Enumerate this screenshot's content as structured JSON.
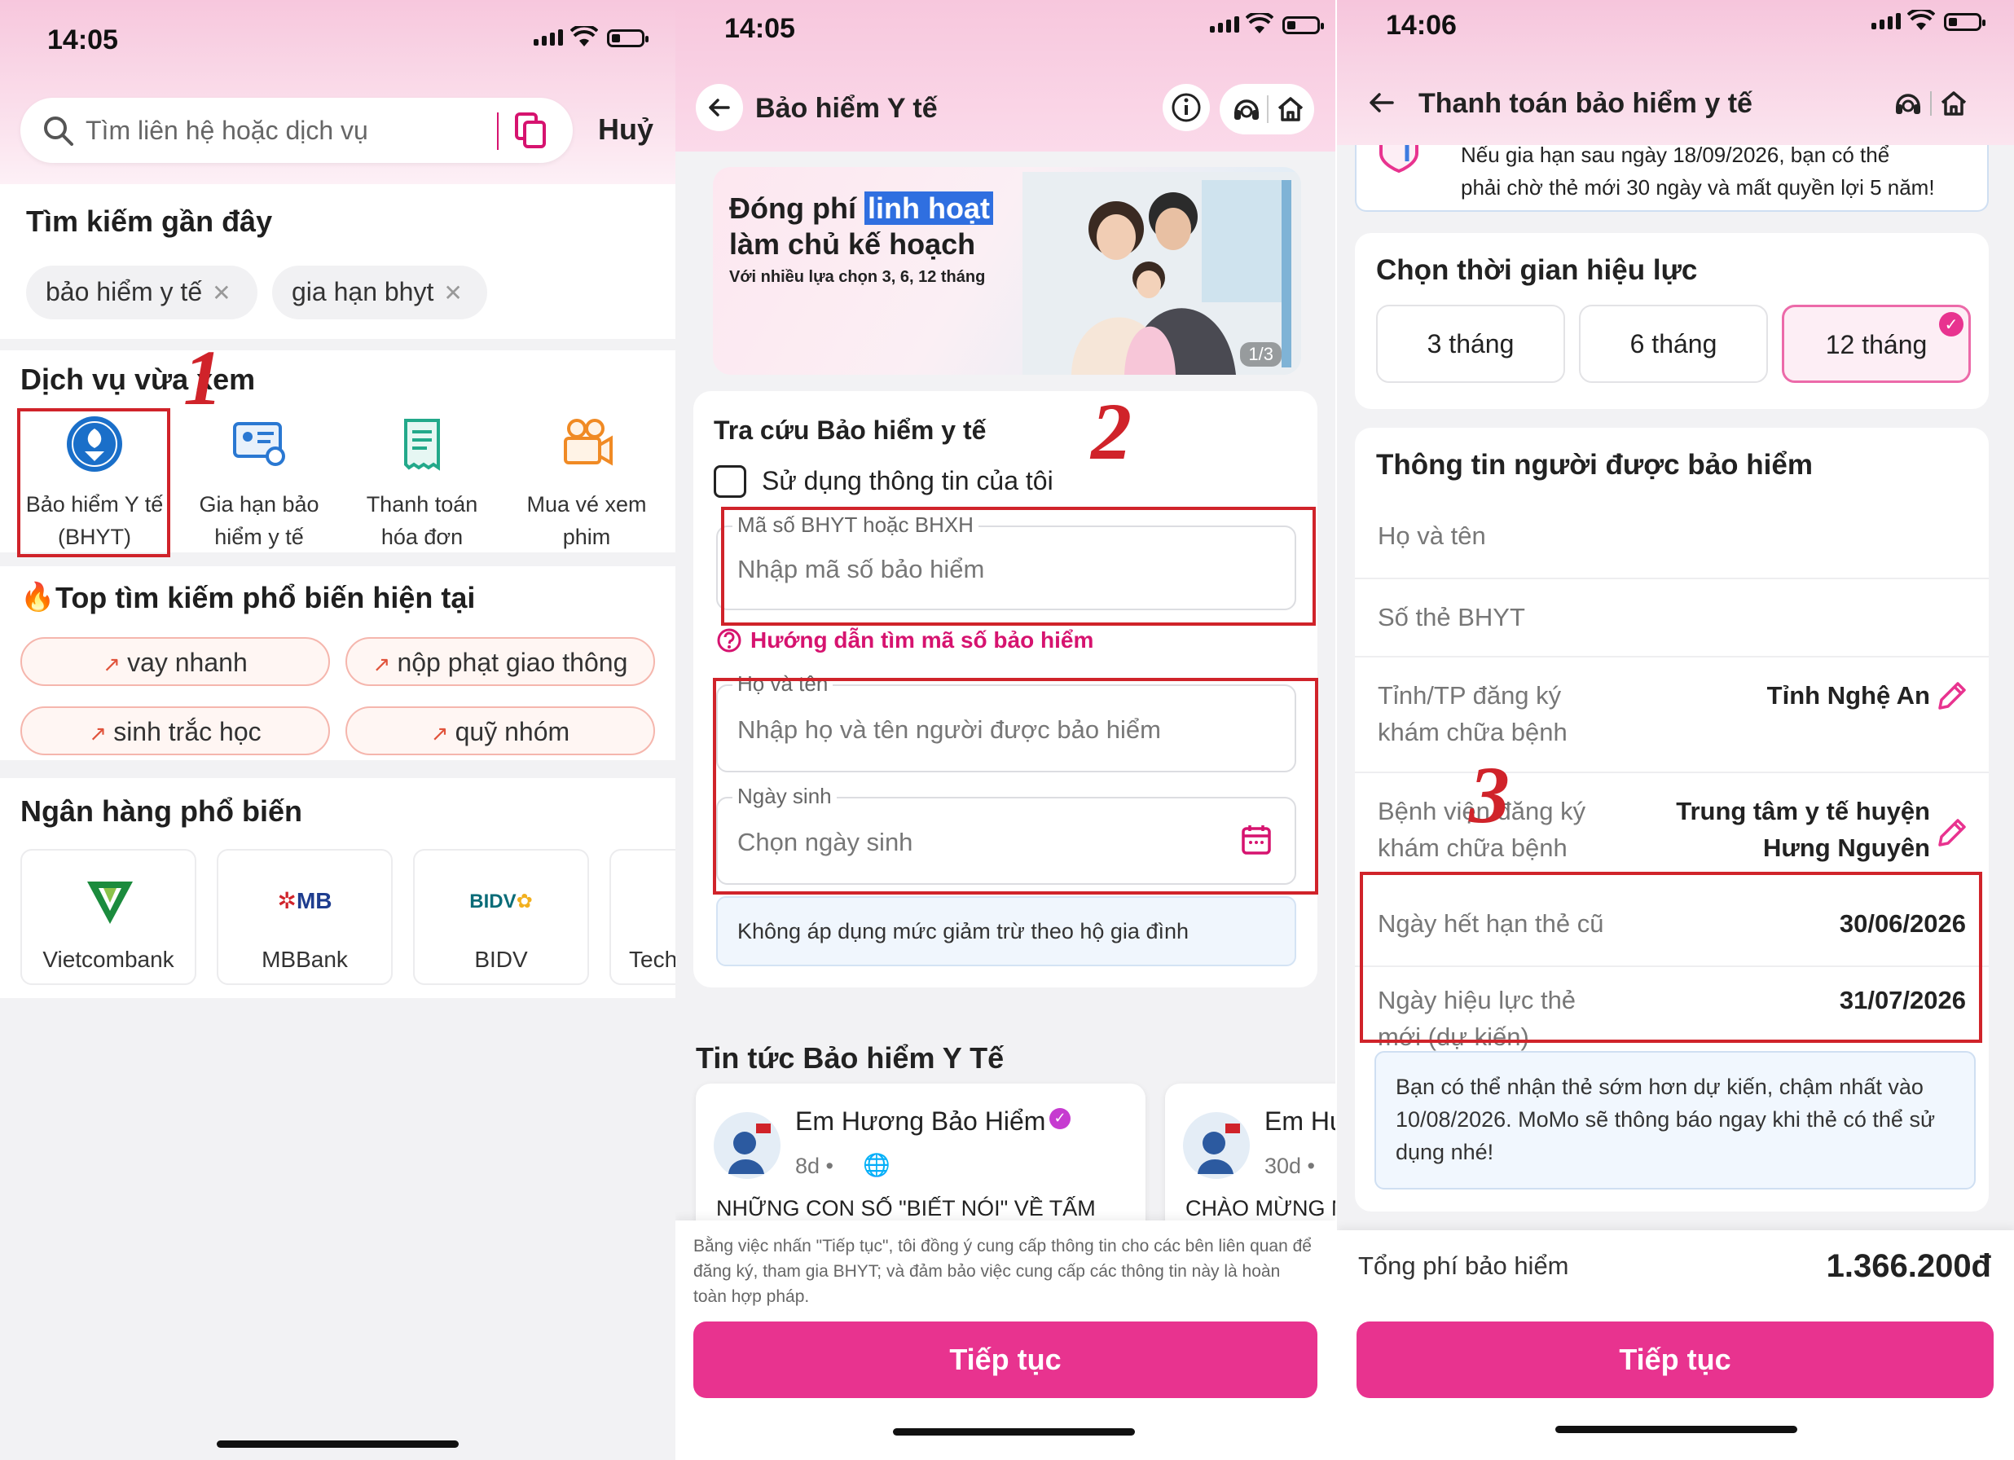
{
  "panel1": {
    "time": "14:05",
    "search_placeholder": "Tìm liên hệ hoặc dịch vụ",
    "cancel": "Huỷ",
    "recent_title": "Tìm kiếm gần đây",
    "recent": [
      "bảo hiểm y tế",
      "gia hạn bhyt"
    ],
    "viewed_title": "Dịch vụ vừa xem",
    "services": [
      {
        "line1": "Bảo hiểm Y tế",
        "line2": "(BHYT)",
        "icon": "health-insurance-logo-icon"
      },
      {
        "line1": "Gia hạn bảo",
        "line2": "hiểm y tế",
        "icon": "renew-card-icon"
      },
      {
        "line1": "Thanh toán",
        "line2": "hóa đơn",
        "icon": "bill-receipt-icon"
      },
      {
        "line1": "Mua vé xem",
        "line2": "phim",
        "icon": "movie-camera-icon"
      }
    ],
    "popular_title": "Top tìm kiếm phổ biến hiện tại",
    "popular": [
      "vay nhanh",
      "nộp phạt giao thông",
      "sinh trắc học",
      "quỹ nhóm"
    ],
    "banks_title": "Ngân hàng phổ biến",
    "banks": [
      "Vietcombank",
      "MBBank",
      "BIDV",
      "Tech"
    ],
    "bank_logos": {
      "mb": "MB",
      "bidv": "BIDV"
    },
    "step": "1"
  },
  "panel2": {
    "time": "14:05",
    "title": "Bảo hiểm Y tế",
    "banner": {
      "line1a": "Đóng phí",
      "line1b": "linh hoạt",
      "line2": "làm chủ kế hoạch",
      "line3": "Với nhiều lựa chọn 3, 6, 12 tháng",
      "pager": "1/3"
    },
    "lookup_title": "Tra cứu Bảo hiểm y tế",
    "use_my_info": "Sử dụng thông tin của tôi",
    "code_label": "Mã số BHYT hoặc BHXH",
    "code_placeholder": "Nhập mã số bảo hiểm",
    "guide": "Hướng dẫn tìm mã số bảo hiểm",
    "name_label": "Họ và tên",
    "name_placeholder": "Nhập họ và tên người được bảo hiểm",
    "dob_label": "Ngày sinh",
    "dob_placeholder": "Chọn ngày sinh",
    "household_note": "Không áp dụng mức giảm trừ theo hộ gia đình",
    "news_title": "Tin tức Bảo hiểm Y Tế",
    "news": [
      {
        "author": "Em Hương Bảo Hiểm",
        "age": "8d •",
        "headline": "NHỮNG CON SỐ \"BIẾT NÓI\" VỀ TẤM"
      },
      {
        "author": "Em Hư",
        "age": "30d •",
        "headline": "CHÀO MỪNG N"
      }
    ],
    "consent": "Bằng việc nhấn \"Tiếp tục\", tôi đồng ý cung cấp thông tin cho các bên liên quan để đăng ký, tham gia BHYT; và đảm bảo việc cung cấp các thông tin này là hoàn toàn hợp pháp.",
    "continue": "Tiếp tục",
    "step": "2"
  },
  "panel3": {
    "time": "14:06",
    "title": "Thanh toán bảo hiểm y tế",
    "warning_line1": "Nếu gia hạn sau ngày 18/09/2026, bạn có thể",
    "warning_line2": "phải chờ thẻ mới 30 ngày và mất quyền lợi 5 năm!",
    "duration_title": "Chọn thời gian hiệu lực",
    "durations": [
      "3 tháng",
      "6 tháng",
      "12 tháng"
    ],
    "selected_duration": "12 tháng",
    "insured_title": "Thông tin người được bảo hiểm",
    "full_name_label": "Họ và tên",
    "card_no_label": "Số thẻ BHYT",
    "province_label_1": "Tỉnh/TP đăng ký",
    "province_label_2": "khám chữa bệnh",
    "province_value": "Tỉnh Nghệ An",
    "hospital_label_1": "Bệnh viện đăng ký",
    "hospital_label_2": "khám chữa bệnh",
    "hospital_value_1": "Trung tâm y tế huyện",
    "hospital_value_2": "Hưng Nguyên",
    "old_expiry_label": "Ngày hết hạn thẻ cũ",
    "old_expiry_value": "30/06/2026",
    "new_effective_label_1": "Ngày hiệu lực thẻ",
    "new_effective_label_2": "mới (dự kiến)",
    "new_effective_value": "31/07/2026",
    "info_note": "Bạn có thể nhận thẻ sớm hơn dự kiến, chậm nhất vào 10/08/2026. MoMo sẽ thông báo ngay khi thẻ có thể sử dụng nhé!",
    "total_label": "Tổng phí bảo hiểm",
    "total_value": "1.366.200đ",
    "continue": "Tiếp tục",
    "step": "3"
  },
  "colors": {
    "accent": "#e8338f",
    "highlight": "#d0232a",
    "link": "#d6136f"
  }
}
